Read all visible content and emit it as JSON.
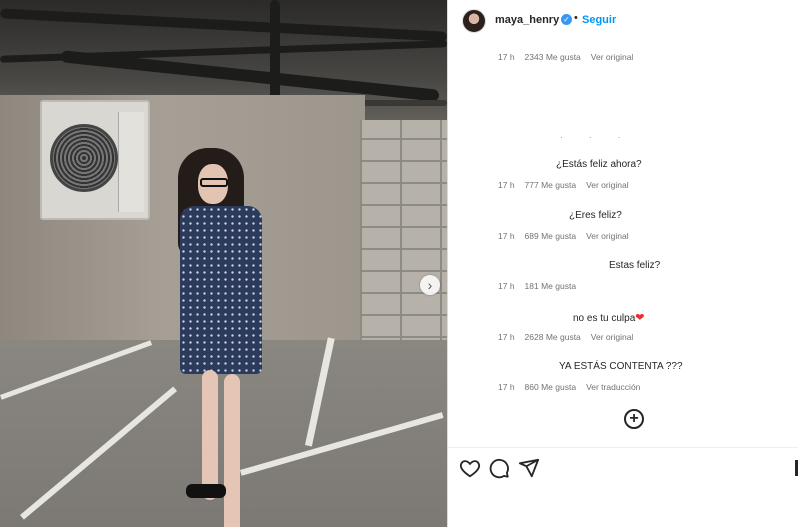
{
  "post": {
    "username": "maya_henry",
    "separator": "•",
    "follow_label": "Seguir",
    "verified_glyph": "✓",
    "next_glyph": "›",
    "add_glyph": "+"
  },
  "comments": [
    {
      "text": "",
      "time": "17 h",
      "likes": "2343 Me gusta",
      "action": "Ver original"
    },
    {
      "text": "¿Estás feliz ahora?",
      "time": "17 h",
      "likes": "777 Me gusta",
      "action": "Ver original"
    },
    {
      "text": "¿Eres feliz?",
      "time": "17 h",
      "likes": "689 Me gusta",
      "action": "Ver original"
    },
    {
      "text": "Estas feliz?",
      "time": "17 h",
      "likes": "181 Me gusta",
      "action": ""
    },
    {
      "text": "no es tu culpa",
      "emoji": "❤",
      "time": "17 h",
      "likes": "2628 Me gusta",
      "action": "Ver original"
    },
    {
      "text": "YA ESTÁS CONTENTA ???",
      "time": "17 h",
      "likes": "860 Me gusta",
      "action": "Ver traducción"
    }
  ],
  "icons": {
    "like": "heart-icon",
    "comment": "comment-icon",
    "share": "share-icon",
    "add": "plus-circle-icon",
    "verified": "verified-badge-icon",
    "next": "chevron-right-icon"
  },
  "colors": {
    "accent": "#0095f6",
    "verified": "#3897f0",
    "heart": "#ed2d2d",
    "meta": "#737373"
  }
}
